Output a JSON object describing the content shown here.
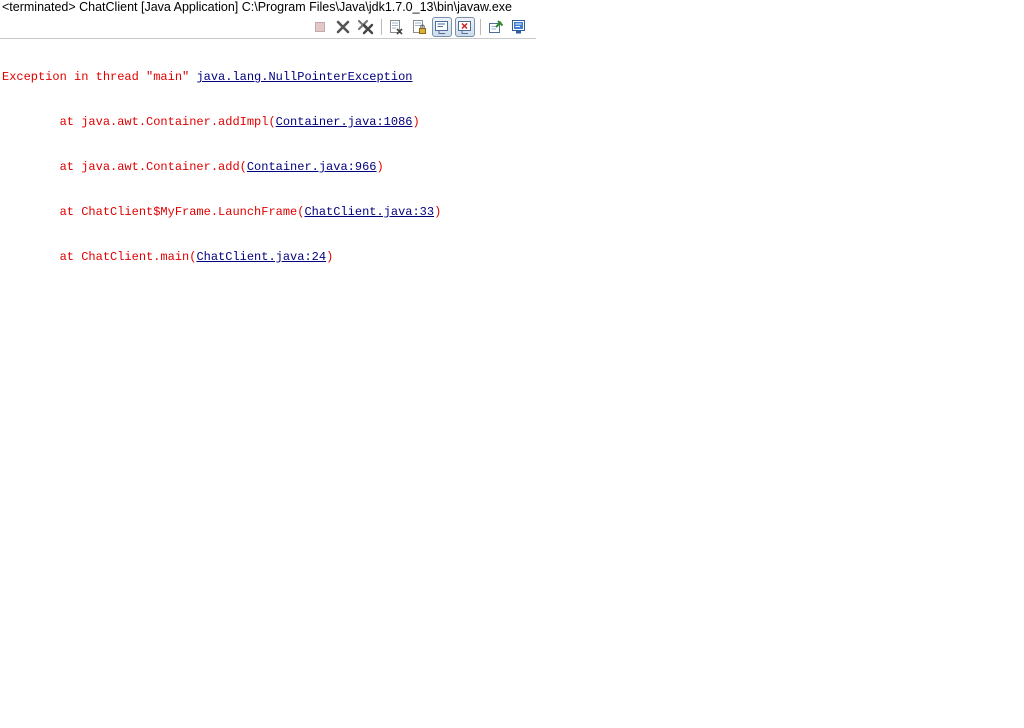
{
  "console": {
    "header": "<terminated> ChatClient [Java Application] C:\\Program Files\\Java\\jdk1.7.0_13\\bin\\javaw.exe"
  },
  "toolbar": {
    "icons": [
      "terminate-icon",
      "remove-launch-icon",
      "remove-all-terminated-icon",
      "clear-console-icon",
      "scroll-lock-icon",
      "show-console-on-stdout-icon",
      "show-console-on-stderr-icon",
      "pin-console-icon",
      "display-selected-console-icon"
    ],
    "pressed": [
      "show-console-on-stdout-icon",
      "show-console-on-stderr-icon"
    ]
  },
  "output": {
    "colors": {
      "error_text": "#e00000",
      "link": "#00007f"
    },
    "lines": [
      {
        "prefix": "Exception in thread \"main\" ",
        "link": "java.lang.NullPointerException",
        "suffix": ""
      },
      {
        "prefix": "\tat java.awt.Container.addImpl(",
        "link": "Container.java:1086",
        "suffix": ")"
      },
      {
        "prefix": "\tat java.awt.Container.add(",
        "link": "Container.java:966",
        "suffix": ")"
      },
      {
        "prefix": "\tat ChatClient$MyFrame.LaunchFrame(",
        "link": "ChatClient.java:33",
        "suffix": ")"
      },
      {
        "prefix": "\tat ChatClient.main(",
        "link": "ChatClient.java:24",
        "suffix": ")"
      }
    ]
  }
}
